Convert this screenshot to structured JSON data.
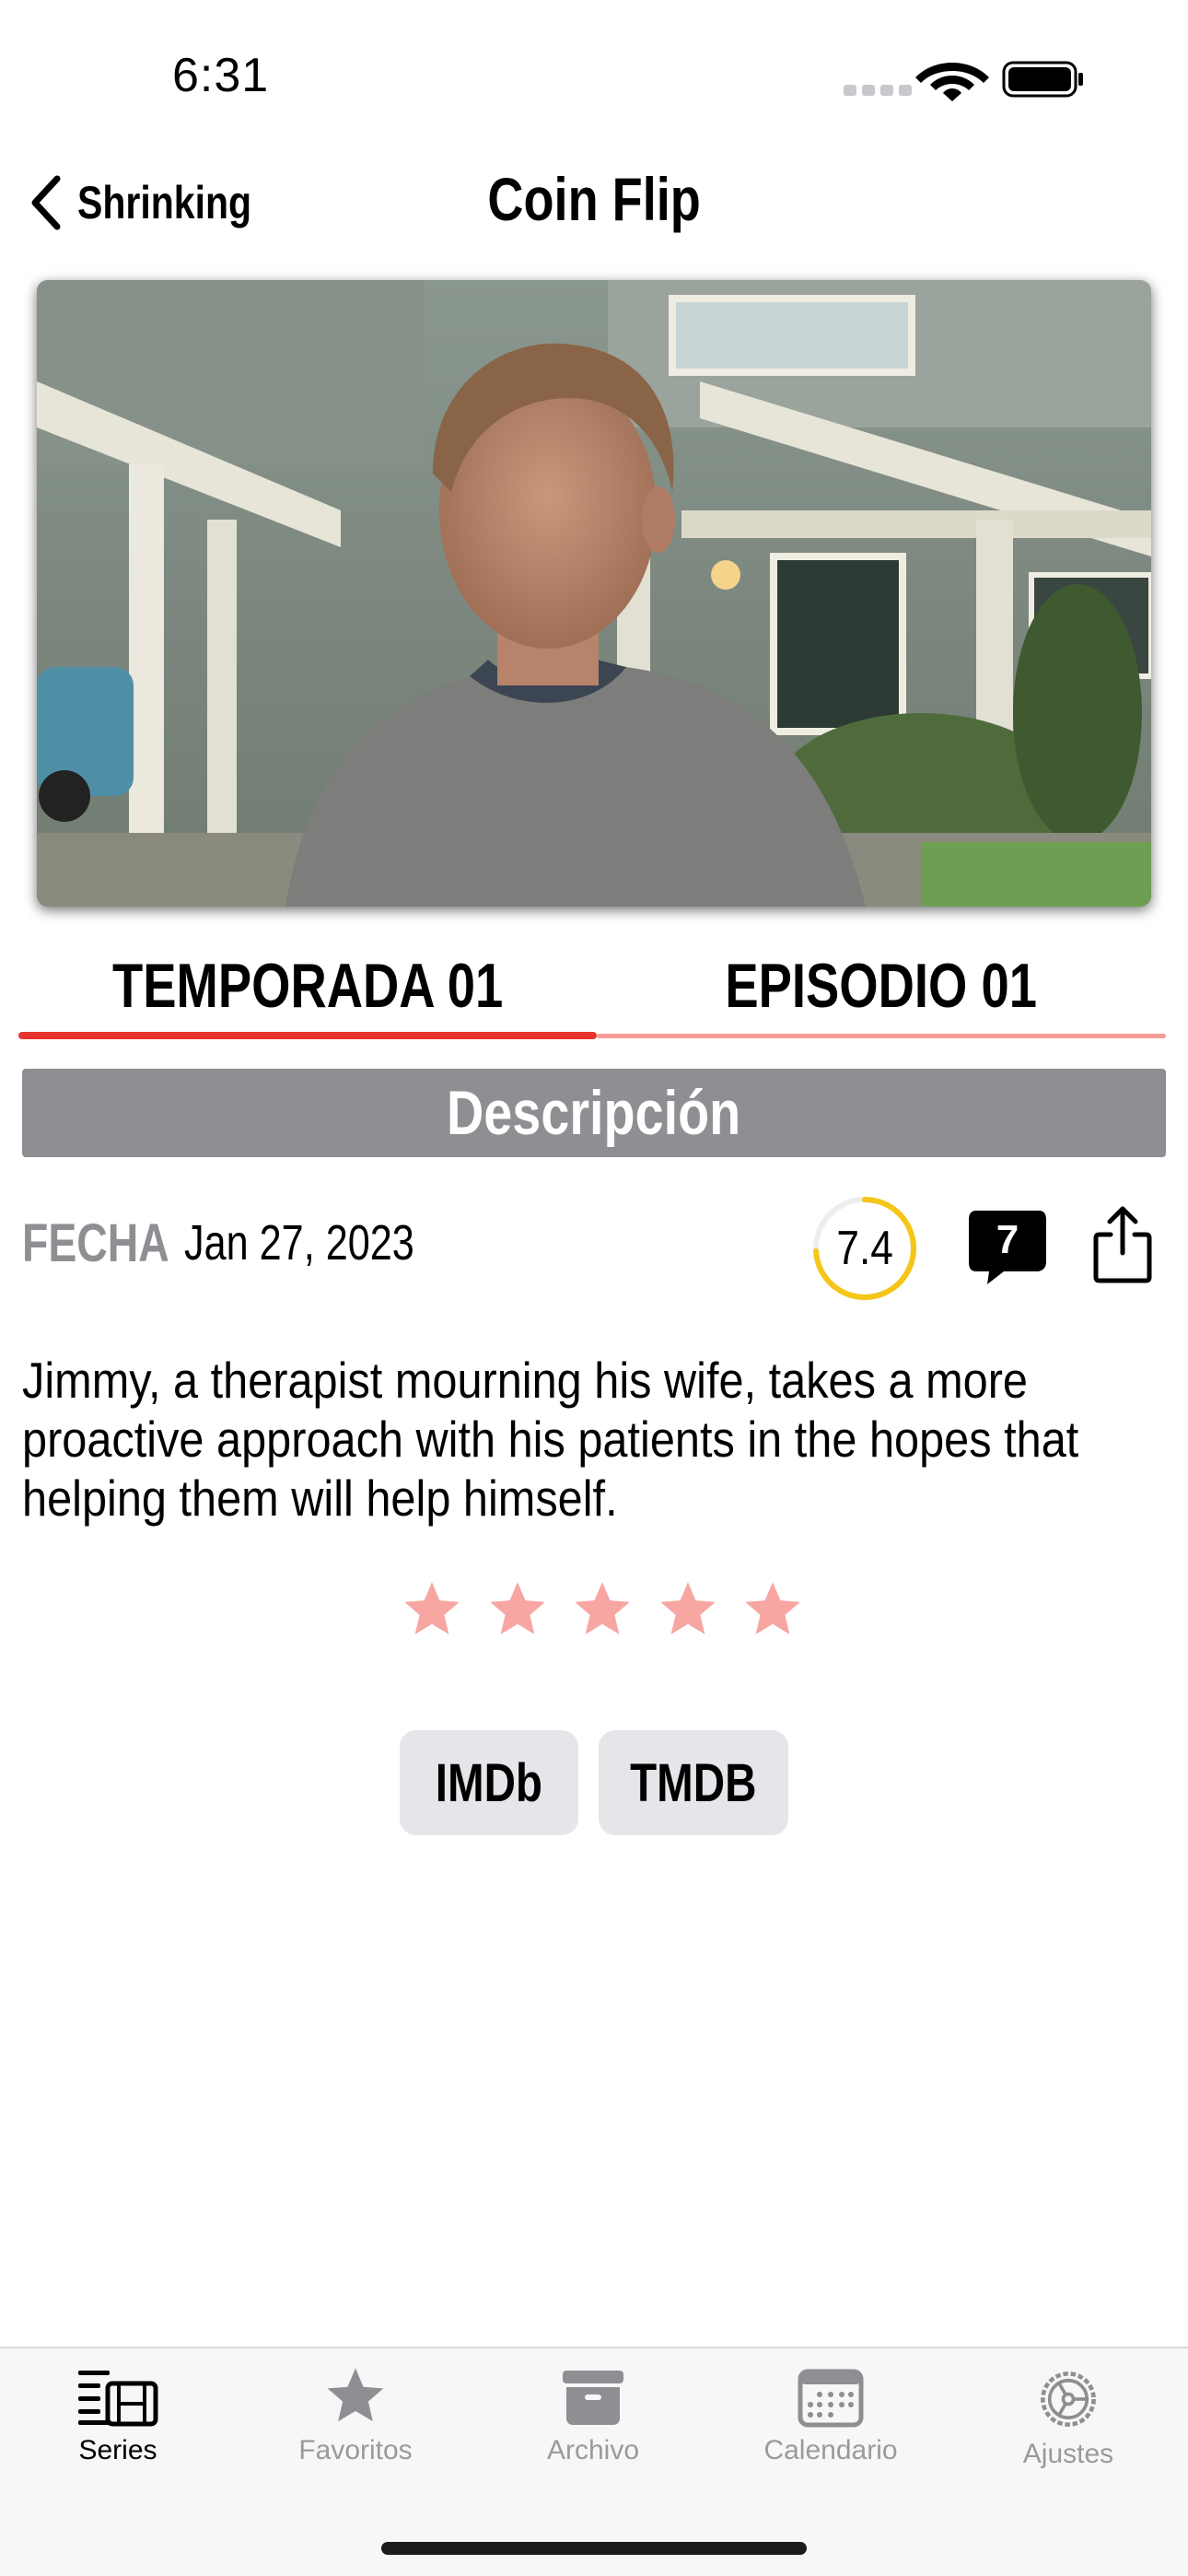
{
  "status_bar": {
    "time": "6:31"
  },
  "nav": {
    "back_label": "Shrinking",
    "title": "Coin Flip"
  },
  "hero": {
    "description": "Episode still"
  },
  "tabs": {
    "season": "TEMPORADA 01",
    "episode": "EPISODIO 01",
    "active": "season"
  },
  "section": {
    "title": "Descripción"
  },
  "episode": {
    "date_label": "FECHA",
    "date": "Jan 27, 2023",
    "rating": "7.4",
    "rating_fraction": 0.74,
    "comments": "7",
    "overview": "Jimmy, a therapist mourning his wife, takes a more proactive approach with his patients in the hopes that helping them will help himself.",
    "user_stars": 0,
    "max_stars": 5
  },
  "links": {
    "imdb": "IMDb",
    "tmdb": "TMDB"
  },
  "tabbar": {
    "items": [
      {
        "label": "Series",
        "icon": "series-icon",
        "active": true
      },
      {
        "label": "Favoritos",
        "icon": "star-icon",
        "active": false
      },
      {
        "label": "Archivo",
        "icon": "archive-icon",
        "active": false
      },
      {
        "label": "Calendario",
        "icon": "calendar-icon",
        "active": false
      },
      {
        "label": "Ajustes",
        "icon": "gear-icon",
        "active": false
      }
    ]
  },
  "colors": {
    "accent": "#e8342e",
    "accent_light": "#f49b95",
    "rating_ring": "#f5c518",
    "star": "#f7a6a2",
    "section_bg": "#8e8e93",
    "button_bg": "#e5e5ea"
  }
}
